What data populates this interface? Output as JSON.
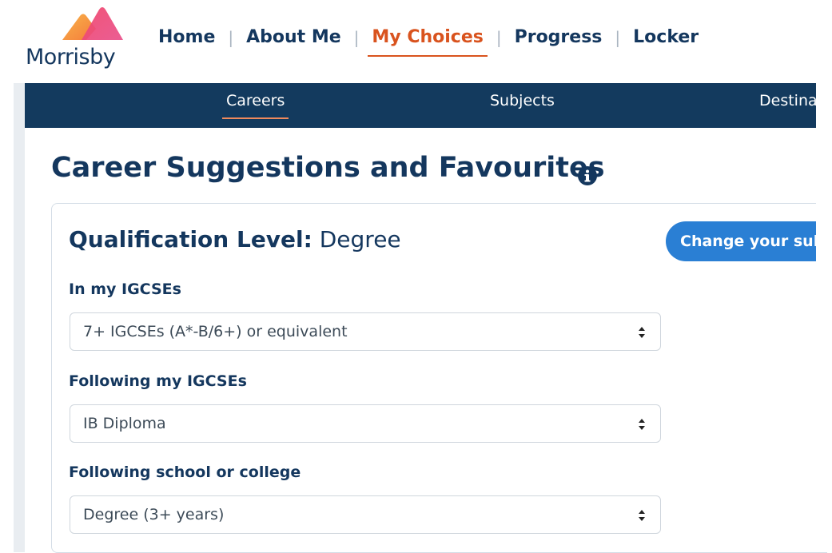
{
  "brand": {
    "name": "Morrisby",
    "colors": {
      "navy": "#133a5e",
      "accent_orange": "#d9531e",
      "button_blue": "#2a7fd4"
    }
  },
  "main_nav": {
    "items": [
      {
        "label": "Home",
        "active": false
      },
      {
        "label": "About Me",
        "active": false
      },
      {
        "label": "My Choices",
        "active": true
      },
      {
        "label": "Progress",
        "active": false
      },
      {
        "label": "Locker",
        "active": false
      }
    ],
    "separator": "|"
  },
  "sub_nav": {
    "tabs": [
      {
        "label": "Careers",
        "active": true
      },
      {
        "label": "Subjects",
        "active": false
      },
      {
        "label": "Destinations",
        "active": false
      }
    ]
  },
  "page": {
    "title": "Career Suggestions and Favourites",
    "info_icon": "info-circle-icon"
  },
  "qualification": {
    "label": "Qualification Level:",
    "value": "Degree",
    "change_button": "Change your subjects"
  },
  "fields": [
    {
      "label": "In my IGCSEs",
      "selected": "7+ IGCSEs (A*-B/6+) or equivalent"
    },
    {
      "label": "Following my IGCSEs",
      "selected": "IB Diploma"
    },
    {
      "label": "Following school or college",
      "selected": "Degree (3+ years)"
    }
  ]
}
